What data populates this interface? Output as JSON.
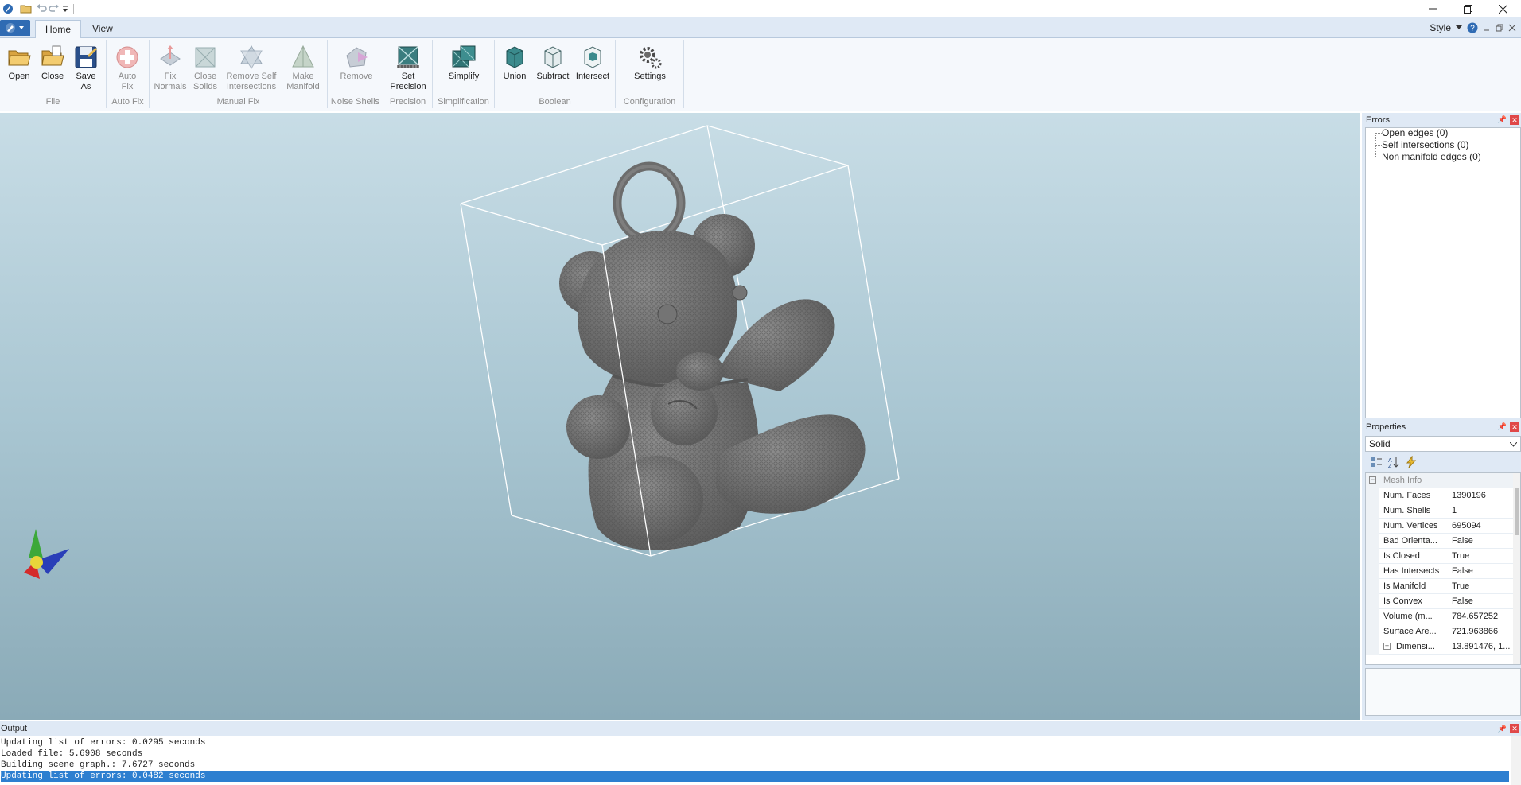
{
  "title_bar": {
    "quick_access": [
      "app-icon",
      "open-folder-icon",
      "undo-icon",
      "redo-icon",
      "customize-icon"
    ],
    "window_buttons": [
      "minimize",
      "restore",
      "close"
    ]
  },
  "tabs": [
    {
      "label": "Home",
      "active": true
    },
    {
      "label": "View",
      "active": false
    }
  ],
  "style_menu": {
    "label": "Style"
  },
  "ribbon": {
    "groups": [
      {
        "label": "File",
        "buttons": [
          {
            "label": "Open",
            "enabled": true
          },
          {
            "label": "Close",
            "enabled": true
          },
          {
            "label": "Save As",
            "enabled": true
          }
        ]
      },
      {
        "label": "Auto Fix",
        "buttons": [
          {
            "label": "Auto Fix",
            "enabled": false
          }
        ]
      },
      {
        "label": "Manual Fix",
        "buttons": [
          {
            "label": "Fix Normals",
            "enabled": false
          },
          {
            "label": "Close Solids",
            "enabled": false
          },
          {
            "label": "Remove Self Intersections",
            "enabled": false
          },
          {
            "label": "Make Manifold",
            "enabled": false
          }
        ]
      },
      {
        "label": "Noise Shells",
        "buttons": [
          {
            "label": "Remove",
            "enabled": false
          }
        ]
      },
      {
        "label": "Precision",
        "buttons": [
          {
            "label": "Set Precision",
            "enabled": true
          }
        ]
      },
      {
        "label": "Simplification",
        "buttons": [
          {
            "label": "Simplify",
            "enabled": true
          }
        ]
      },
      {
        "label": "Boolean",
        "buttons": [
          {
            "label": "Union",
            "enabled": true
          },
          {
            "label": "Subtract",
            "enabled": true
          },
          {
            "label": "Intersect",
            "enabled": true
          }
        ]
      },
      {
        "label": "Configuration",
        "buttons": [
          {
            "label": "Settings",
            "enabled": true
          }
        ]
      }
    ]
  },
  "errors_panel": {
    "title": "Errors",
    "items": [
      "Open edges (0)",
      "Self intersections (0)",
      "Non manifold edges (0)"
    ]
  },
  "properties_panel": {
    "title": "Properties",
    "selected_object": "Solid",
    "category": "Mesh Info",
    "rows": [
      {
        "name": "Num. Faces",
        "value": "1390196"
      },
      {
        "name": "Num. Shells",
        "value": "1"
      },
      {
        "name": "Num. Vertices",
        "value": "695094"
      },
      {
        "name": "Bad Orienta...",
        "value": "False"
      },
      {
        "name": "Is Closed",
        "value": "True"
      },
      {
        "name": "Has Intersects",
        "value": "False"
      },
      {
        "name": "Is Manifold",
        "value": "True"
      },
      {
        "name": "Is Convex",
        "value": "False"
      },
      {
        "name": "Volume (m...",
        "value": "784.657252"
      },
      {
        "name": "Surface Are...",
        "value": "721.963866"
      },
      {
        "name": "Dimensi...",
        "value": "13.891476, 1..."
      }
    ]
  },
  "output_panel": {
    "title": "Output",
    "lines": [
      "Updating list of errors: 0.0295 seconds",
      "Loaded file: 5.6908 seconds",
      "Building scene graph.: 7.6727 seconds",
      "Updating list of errors: 0.0482 seconds"
    ]
  },
  "colors": {
    "ribbon_bg": "#f5f8fc",
    "tab_strip": "#dfe9f5",
    "viewport_top": "#c8dde6",
    "viewport_bottom": "#8aaab7",
    "mesh": "#6e6e6e",
    "selection": "#2d7fd0",
    "close_red": "#e04848"
  }
}
